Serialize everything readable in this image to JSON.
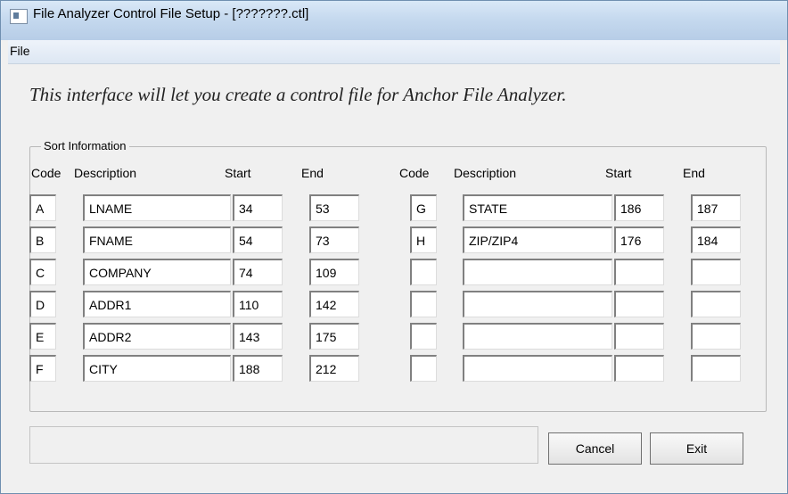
{
  "window": {
    "title": "File Analyzer Control File Setup - [???????.ctl]"
  },
  "menu": {
    "file": "File"
  },
  "intro": "This interface will let you create a control file for Anchor File Analyzer.",
  "group_label": "Sort Information",
  "headers": {
    "code": "Code",
    "description": "Description",
    "start": "Start",
    "end": "End"
  },
  "left_rows": [
    {
      "code": "A",
      "description": "LNAME",
      "start": "34",
      "end": "53"
    },
    {
      "code": "B",
      "description": "FNAME",
      "start": "54",
      "end": "73"
    },
    {
      "code": "C",
      "description": "COMPANY",
      "start": "74",
      "end": "109"
    },
    {
      "code": "D",
      "description": "ADDR1",
      "start": "110",
      "end": "142"
    },
    {
      "code": "E",
      "description": "ADDR2",
      "start": "143",
      "end": "175"
    },
    {
      "code": "F",
      "description": "CITY",
      "start": "188",
      "end": "212"
    }
  ],
  "right_rows": [
    {
      "code": "G",
      "description": "STATE",
      "start": "186",
      "end": "187"
    },
    {
      "code": "H",
      "description": "ZIP/ZIP4",
      "start": "176",
      "end": "184"
    },
    {
      "code": "",
      "description": "",
      "start": "",
      "end": ""
    },
    {
      "code": "",
      "description": "",
      "start": "",
      "end": ""
    },
    {
      "code": "",
      "description": "",
      "start": "",
      "end": ""
    },
    {
      "code": "",
      "description": "",
      "start": "",
      "end": ""
    }
  ],
  "status_text": "",
  "buttons": {
    "cancel": "Cancel",
    "exit": "Exit"
  }
}
